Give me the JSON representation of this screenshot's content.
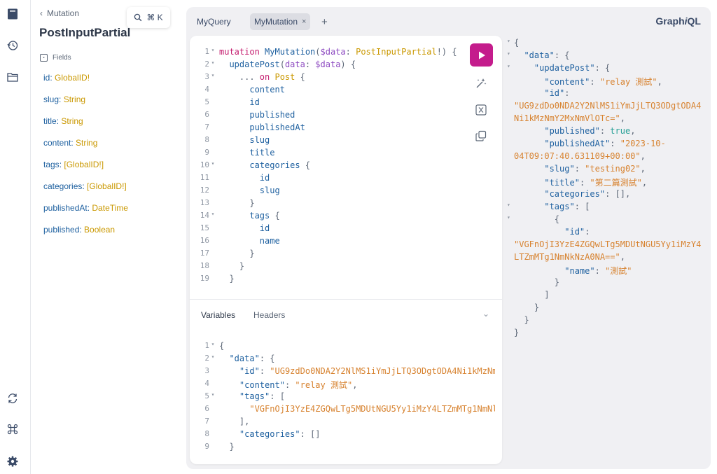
{
  "app": {
    "brand_prefix": "Graph",
    "brand_italic": "i",
    "brand_suffix": "QL"
  },
  "rail": {
    "icons": [
      "docs-icon",
      "history-icon",
      "explorer-icon",
      "refresh-icon",
      "shortcut-icon",
      "settings-icon"
    ]
  },
  "docs": {
    "back_label": "Mutation",
    "title": "PostInputPartial",
    "search_shortcut": "⌘ K",
    "fields_label": "Fields",
    "fields": [
      {
        "name": "id",
        "type": "GlobalID!"
      },
      {
        "name": "slug",
        "type": "String"
      },
      {
        "name": "title",
        "type": "String"
      },
      {
        "name": "content",
        "type": "String"
      },
      {
        "name": "tags",
        "type": "[GlobalID!]"
      },
      {
        "name": "categories",
        "type": "[GlobalID!]"
      },
      {
        "name": "publishedAt",
        "type": "DateTime"
      },
      {
        "name": "published",
        "type": "Boolean"
      }
    ]
  },
  "tabs": [
    {
      "label": "MyQuery",
      "active": false
    },
    {
      "label": "MyMutation",
      "active": true,
      "close": "×"
    }
  ],
  "tab_add": "+",
  "editor": {
    "lines": [
      {
        "n": "1",
        "fold": "▾",
        "segs": [
          [
            "kw",
            "mutation "
          ],
          [
            "def",
            "MyMutation"
          ],
          [
            "pun",
            "("
          ],
          [
            "var",
            "$data"
          ],
          [
            "pun",
            ": "
          ],
          [
            "typ",
            "PostInputPartial"
          ],
          [
            "pun",
            "!) {"
          ]
        ]
      },
      {
        "n": "2",
        "fold": "▾",
        "segs": [
          [
            "pun",
            "  "
          ],
          [
            "fld",
            "updatePost"
          ],
          [
            "pun",
            "("
          ],
          [
            "var",
            "data"
          ],
          [
            "pun",
            ": "
          ],
          [
            "var",
            "$data"
          ],
          [
            "pun",
            ") {"
          ]
        ]
      },
      {
        "n": "3",
        "fold": "▾",
        "segs": [
          [
            "pun",
            "    ... "
          ],
          [
            "kw",
            "on "
          ],
          [
            "typ",
            "Post"
          ],
          [
            "pun",
            " {"
          ]
        ]
      },
      {
        "n": "4",
        "fold": "",
        "segs": [
          [
            "pun",
            "      "
          ],
          [
            "fld",
            "content"
          ]
        ]
      },
      {
        "n": "5",
        "fold": "",
        "segs": [
          [
            "pun",
            "      "
          ],
          [
            "fld",
            "id"
          ]
        ]
      },
      {
        "n": "6",
        "fold": "",
        "segs": [
          [
            "pun",
            "      "
          ],
          [
            "fld",
            "published"
          ]
        ]
      },
      {
        "n": "7",
        "fold": "",
        "segs": [
          [
            "pun",
            "      "
          ],
          [
            "fld",
            "publishedAt"
          ]
        ]
      },
      {
        "n": "8",
        "fold": "",
        "segs": [
          [
            "pun",
            "      "
          ],
          [
            "fld",
            "slug"
          ]
        ]
      },
      {
        "n": "9",
        "fold": "",
        "segs": [
          [
            "pun",
            "      "
          ],
          [
            "fld",
            "title"
          ]
        ]
      },
      {
        "n": "10",
        "fold": "▾",
        "segs": [
          [
            "pun",
            "      "
          ],
          [
            "fld",
            "categories"
          ],
          [
            "pun",
            " {"
          ]
        ]
      },
      {
        "n": "11",
        "fold": "",
        "segs": [
          [
            "pun",
            "        "
          ],
          [
            "fld",
            "id"
          ]
        ]
      },
      {
        "n": "12",
        "fold": "",
        "segs": [
          [
            "pun",
            "        "
          ],
          [
            "fld",
            "slug"
          ]
        ]
      },
      {
        "n": "13",
        "fold": "",
        "segs": [
          [
            "pun",
            "      }"
          ]
        ]
      },
      {
        "n": "14",
        "fold": "▾",
        "segs": [
          [
            "pun",
            "      "
          ],
          [
            "fld",
            "tags"
          ],
          [
            "pun",
            " {"
          ]
        ]
      },
      {
        "n": "15",
        "fold": "",
        "segs": [
          [
            "pun",
            "        "
          ],
          [
            "fld",
            "id"
          ]
        ]
      },
      {
        "n": "16",
        "fold": "",
        "segs": [
          [
            "pun",
            "        "
          ],
          [
            "fld",
            "name"
          ]
        ]
      },
      {
        "n": "17",
        "fold": "",
        "segs": [
          [
            "pun",
            "      }"
          ]
        ]
      },
      {
        "n": "18",
        "fold": "",
        "segs": [
          [
            "pun",
            "    }"
          ]
        ]
      },
      {
        "n": "19",
        "fold": "",
        "segs": [
          [
            "pun",
            "  }"
          ]
        ]
      }
    ]
  },
  "variables": {
    "tab_variables": "Variables",
    "tab_headers": "Headers",
    "collapse": "⌄",
    "lines": [
      {
        "n": "1",
        "fold": "▾",
        "segs": [
          [
            "pun",
            "{"
          ]
        ]
      },
      {
        "n": "2",
        "fold": "▾",
        "segs": [
          [
            "pun",
            "  "
          ],
          [
            "key",
            "\"data\""
          ],
          [
            "pun",
            ": {"
          ]
        ]
      },
      {
        "n": "3",
        "fold": "",
        "segs": [
          [
            "pun",
            "    "
          ],
          [
            "key",
            "\"id\""
          ],
          [
            "pun",
            ": "
          ],
          [
            "str",
            "\"UG9zdDo0NDA2Y2NlMS1iYmJjLTQ3ODgtODA4Ni1kMzNm"
          ]
        ]
      },
      {
        "n": "4",
        "fold": "",
        "segs": [
          [
            "pun",
            "    "
          ],
          [
            "key",
            "\"content\""
          ],
          [
            "pun",
            ": "
          ],
          [
            "str",
            "\"relay 測試\""
          ],
          [
            "pun",
            ","
          ]
        ]
      },
      {
        "n": "5",
        "fold": "▾",
        "segs": [
          [
            "pun",
            "    "
          ],
          [
            "key",
            "\"tags\""
          ],
          [
            "pun",
            ": ["
          ]
        ]
      },
      {
        "n": "6",
        "fold": "",
        "segs": [
          [
            "pun",
            "      "
          ],
          [
            "str",
            "\"VGFnOjI3YzE4ZGQwLTg5MDUtNGU5Yy1iMzY4LTZmMTg1NmNl"
          ]
        ]
      },
      {
        "n": "7",
        "fold": "",
        "segs": [
          [
            "pun",
            "    ],"
          ]
        ]
      },
      {
        "n": "8",
        "fold": "",
        "segs": [
          [
            "pun",
            "    "
          ],
          [
            "key",
            "\"categories\""
          ],
          [
            "pun",
            ": []"
          ]
        ]
      },
      {
        "n": "9",
        "fold": "",
        "segs": [
          [
            "pun",
            "  }"
          ]
        ]
      }
    ]
  },
  "result": {
    "lines": [
      {
        "fold": "▾",
        "segs": [
          [
            "pun",
            "{"
          ]
        ]
      },
      {
        "fold": "▾",
        "segs": [
          [
            "pun",
            "  "
          ],
          [
            "key",
            "\"data\""
          ],
          [
            "pun",
            ": {"
          ]
        ]
      },
      {
        "fold": "▾",
        "segs": [
          [
            "pun",
            "    "
          ],
          [
            "key",
            "\"updatePost\""
          ],
          [
            "pun",
            ": {"
          ]
        ]
      },
      {
        "fold": "",
        "segs": [
          [
            "pun",
            "      "
          ],
          [
            "key",
            "\"content\""
          ],
          [
            "pun",
            ": "
          ],
          [
            "str",
            "\"relay 測試\""
          ],
          [
            "pun",
            ","
          ]
        ]
      },
      {
        "fold": "",
        "segs": [
          [
            "pun",
            "      "
          ],
          [
            "key",
            "\"id\""
          ],
          [
            "pun",
            ":"
          ]
        ]
      },
      {
        "fold": "",
        "segs": [
          [
            "str",
            "\"UG9zdDo0NDA2Y2NlMS1iYmJjLTQ3ODgtODA4"
          ]
        ]
      },
      {
        "fold": "",
        "segs": [
          [
            "str",
            "Ni1kMzNmY2MxNmVlOTc=\""
          ],
          [
            "pun",
            ","
          ]
        ]
      },
      {
        "fold": "",
        "segs": [
          [
            "pun",
            "      "
          ],
          [
            "key",
            "\"published\""
          ],
          [
            "pun",
            ": "
          ],
          [
            "bool",
            "true"
          ],
          [
            "pun",
            ","
          ]
        ]
      },
      {
        "fold": "",
        "segs": [
          [
            "pun",
            "      "
          ],
          [
            "key",
            "\"publishedAt\""
          ],
          [
            "pun",
            ": "
          ],
          [
            "str",
            "\"2023-10-"
          ]
        ]
      },
      {
        "fold": "",
        "segs": [
          [
            "str",
            "04T09:07:40.631109+00:00\""
          ],
          [
            "pun",
            ","
          ]
        ]
      },
      {
        "fold": "",
        "segs": [
          [
            "pun",
            "      "
          ],
          [
            "key",
            "\"slug\""
          ],
          [
            "pun",
            ": "
          ],
          [
            "str",
            "\"testing02\""
          ],
          [
            "pun",
            ","
          ]
        ]
      },
      {
        "fold": "",
        "segs": [
          [
            "pun",
            "      "
          ],
          [
            "key",
            "\"title\""
          ],
          [
            "pun",
            ": "
          ],
          [
            "str",
            "\"第二篇測試\""
          ],
          [
            "pun",
            ","
          ]
        ]
      },
      {
        "fold": "",
        "segs": [
          [
            "pun",
            "      "
          ],
          [
            "key",
            "\"categories\""
          ],
          [
            "pun",
            ": [],"
          ]
        ]
      },
      {
        "fold": "▾",
        "segs": [
          [
            "pun",
            "      "
          ],
          [
            "key",
            "\"tags\""
          ],
          [
            "pun",
            ": ["
          ]
        ]
      },
      {
        "fold": "▾",
        "segs": [
          [
            "pun",
            "        {"
          ]
        ]
      },
      {
        "fold": "",
        "segs": [
          [
            "pun",
            "          "
          ],
          [
            "key",
            "\"id\""
          ],
          [
            "pun",
            ":"
          ]
        ]
      },
      {
        "fold": "",
        "segs": [
          [
            "str",
            "\"VGFnOjI3YzE4ZGQwLTg5MDUtNGU5Yy1iMzY4"
          ]
        ]
      },
      {
        "fold": "",
        "segs": [
          [
            "str",
            "LTZmMTg1NmNkNzA0NA==\""
          ],
          [
            "pun",
            ","
          ]
        ]
      },
      {
        "fold": "",
        "segs": [
          [
            "pun",
            "          "
          ],
          [
            "key",
            "\"name\""
          ],
          [
            "pun",
            ": "
          ],
          [
            "str",
            "\"測試\""
          ]
        ]
      },
      {
        "fold": "",
        "segs": [
          [
            "pun",
            "        }"
          ]
        ]
      },
      {
        "fold": "",
        "segs": [
          [
            "pun",
            "      ]"
          ]
        ]
      },
      {
        "fold": "",
        "segs": [
          [
            "pun",
            "    }"
          ]
        ]
      },
      {
        "fold": "",
        "segs": [
          [
            "pun",
            "  }"
          ]
        ]
      },
      {
        "fold": "",
        "segs": [
          [
            "pun",
            "}"
          ]
        ]
      }
    ]
  }
}
